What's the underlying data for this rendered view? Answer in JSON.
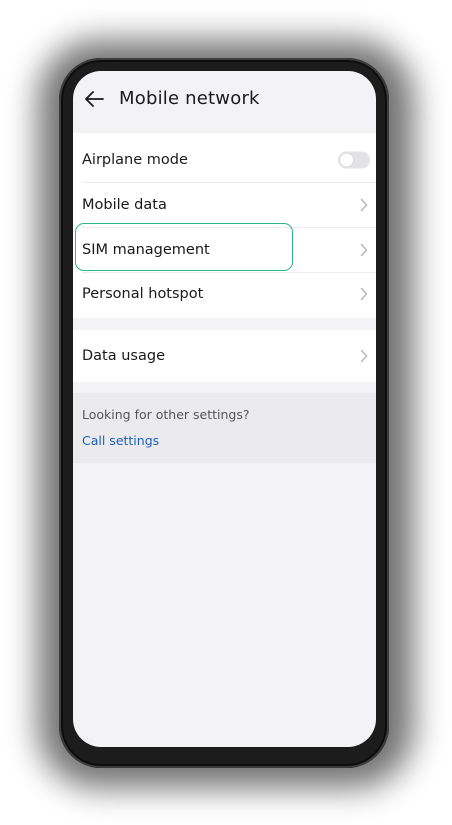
{
  "header": {
    "title": "Mobile network",
    "back_icon": "arrow-left-icon"
  },
  "settings_group": {
    "items": [
      {
        "label": "Airplane mode",
        "control": "toggle",
        "toggle_on": false
      },
      {
        "label": "Mobile data",
        "control": "chevron"
      },
      {
        "label": "SIM management",
        "control": "chevron",
        "highlighted": true
      },
      {
        "label": "Personal hotspot",
        "control": "chevron"
      }
    ]
  },
  "usage_group": {
    "items": [
      {
        "label": "Data usage",
        "control": "chevron"
      }
    ]
  },
  "other_settings": {
    "prompt": "Looking for other settings?",
    "link": "Call settings"
  },
  "colors": {
    "highlight": "#2bb58a",
    "link": "#1b5fb7",
    "background": "#f3f3f5",
    "toggle_off": "#e3e3e6"
  }
}
